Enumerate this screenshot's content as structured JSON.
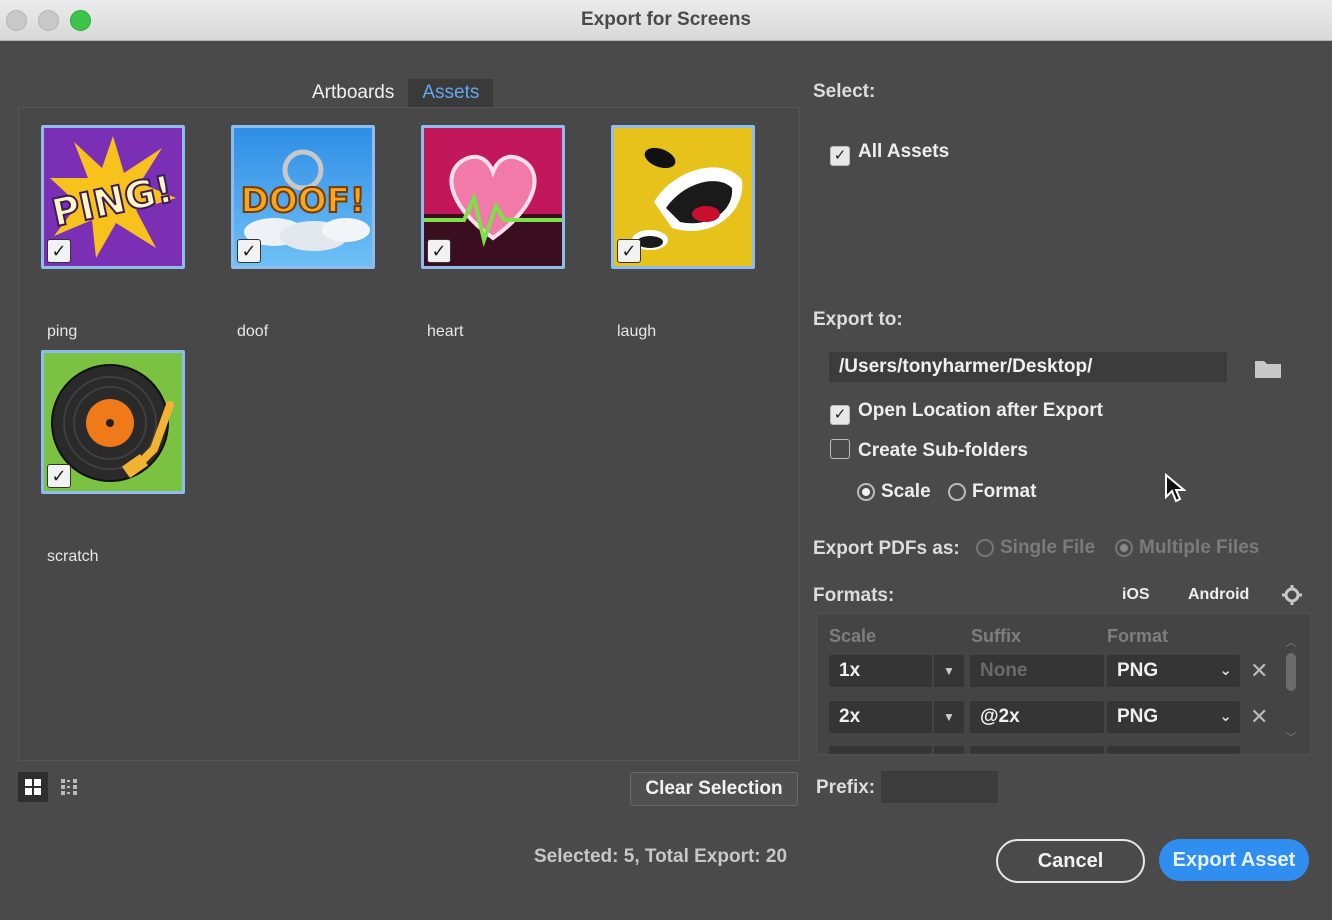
{
  "window": {
    "title": "Export for Screens"
  },
  "tabs": [
    {
      "label": "Artboards",
      "active": false
    },
    {
      "label": "Assets",
      "active": true
    }
  ],
  "assets": [
    {
      "label": "ping",
      "checked": true,
      "icon": "ping-comic-icon"
    },
    {
      "label": "doof",
      "checked": true,
      "icon": "doof-comic-icon"
    },
    {
      "label": "heart",
      "checked": true,
      "icon": "heart-pulse-icon"
    },
    {
      "label": "laugh",
      "checked": true,
      "icon": "laugh-face-icon"
    },
    {
      "label": "scratch",
      "checked": true,
      "icon": "vinyl-record-icon"
    }
  ],
  "bottom": {
    "clear_selection": "Clear Selection",
    "status": "Selected: 5, Total Export: 20"
  },
  "select": {
    "heading": "Select:",
    "all_assets": "All Assets",
    "all_assets_checked": true
  },
  "export_to": {
    "heading": "Export to:",
    "path": "/Users/tonyharmer/Desktop/",
    "open_location": "Open Location after Export",
    "open_location_checked": true,
    "create_subfolders": "Create Sub-folders",
    "create_subfolders_checked": false,
    "scale_label": "Scale",
    "format_label": "Format",
    "subfolder_mode": "Scale"
  },
  "pdf": {
    "heading": "Export PDFs as:",
    "single": "Single File",
    "multiple": "Multiple Files",
    "selected": "Multiple Files"
  },
  "formats": {
    "heading": "Formats:",
    "ios": "iOS",
    "android": "Android",
    "columns": {
      "scale": "Scale",
      "suffix": "Suffix",
      "format": "Format"
    },
    "rows": [
      {
        "scale": "1x",
        "suffix": "",
        "suffix_placeholder": "None",
        "format": "PNG"
      },
      {
        "scale": "2x",
        "suffix": "@2x",
        "suffix_placeholder": "",
        "format": "PNG"
      }
    ]
  },
  "prefix": {
    "label": "Prefix:",
    "value": ""
  },
  "actions": {
    "cancel": "Cancel",
    "export": "Export Asset"
  },
  "colors": {
    "accent": "#2f8ef0",
    "tab_active_text": "#62a8ee",
    "selection_border": "#8fbcec"
  }
}
